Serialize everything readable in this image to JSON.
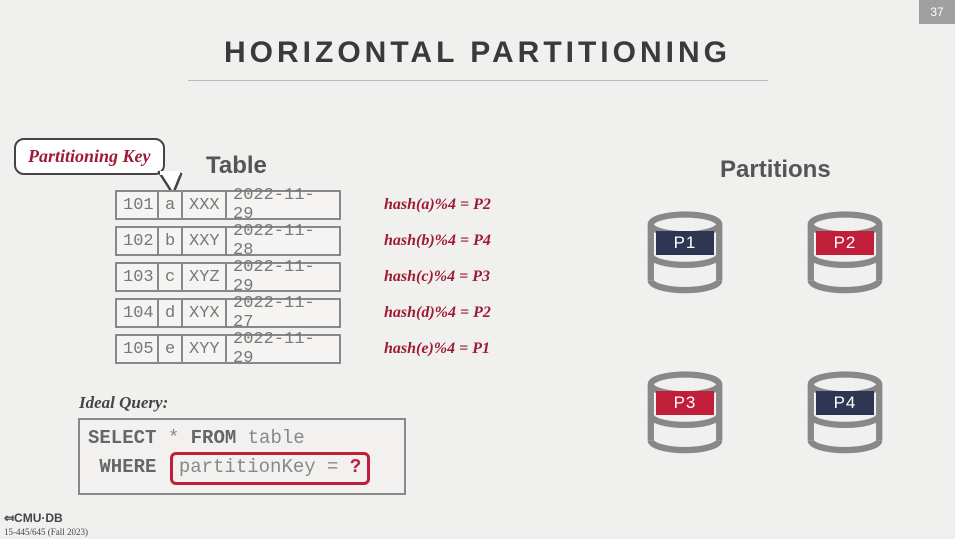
{
  "pagenum": "37",
  "title": "HORIZONTAL PARTITIONING",
  "key_label": "Partitioning Key",
  "table_label": "Table",
  "partitions_label": "Partitions",
  "rows": [
    {
      "c1": "101",
      "c2": "a",
      "c3": "XXX",
      "c4": "2022-11-29",
      "hash": "hash(a)%4 = P2"
    },
    {
      "c1": "102",
      "c2": "b",
      "c3": "XXY",
      "c4": "2022-11-28",
      "hash": "hash(b)%4 = P4"
    },
    {
      "c1": "103",
      "c2": "c",
      "c3": "XYZ",
      "c4": "2022-11-29",
      "hash": "hash(c)%4 = P3"
    },
    {
      "c1": "104",
      "c2": "d",
      "c3": "XYX",
      "c4": "2022-11-27",
      "hash": "hash(d)%4 = P2"
    },
    {
      "c1": "105",
      "c2": "e",
      "c3": "XYY",
      "c4": "2022-11-29",
      "hash": "hash(e)%4 = P1"
    }
  ],
  "ideal_label": "Ideal Query:",
  "query": {
    "kw1": "SELECT",
    "star": "*",
    "kw2": "FROM",
    "tbl": "table",
    "kw3": "WHERE",
    "pred": "partitionKey =",
    "q": "?"
  },
  "partitions": [
    {
      "name": "P1",
      "color": "navy"
    },
    {
      "name": "P2",
      "color": "red"
    },
    {
      "name": "P3",
      "color": "red"
    },
    {
      "name": "P4",
      "color": "navy"
    }
  ],
  "footer_logo": "�andon CMU·DB",
  "footer_text": "15-445/645 (Fall 2023)"
}
